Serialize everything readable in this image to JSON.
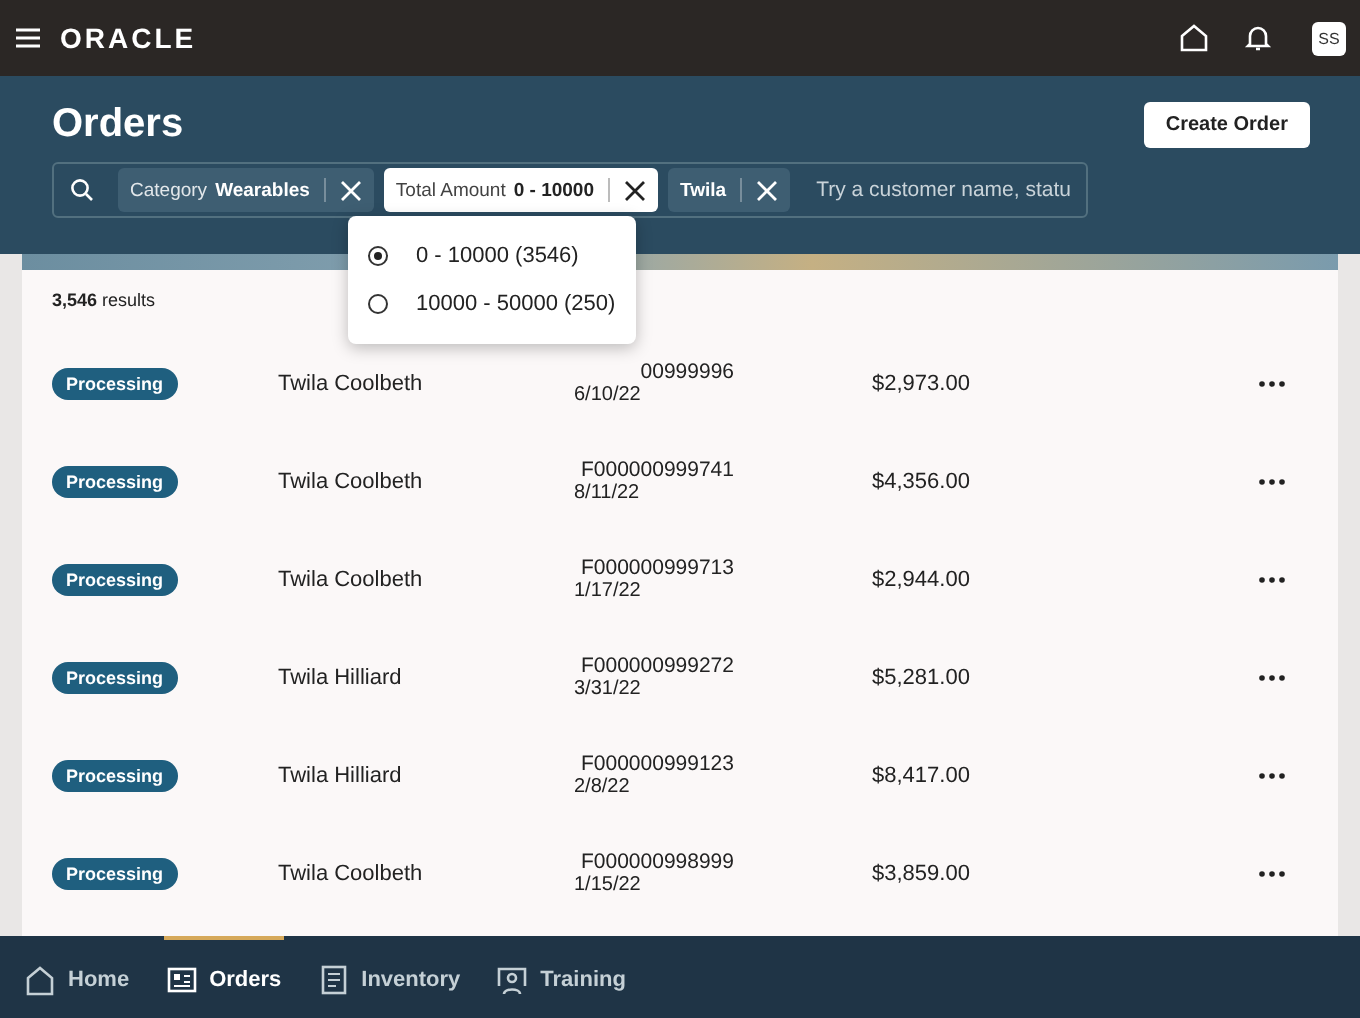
{
  "topbar": {
    "brand": "ORACLE",
    "avatar": "SS"
  },
  "page": {
    "title": "Orders",
    "create_button": "Create Order"
  },
  "filters": {
    "chips": [
      {
        "label": "Category",
        "value": "Wearables",
        "selected": false
      },
      {
        "label": "Total Amount",
        "value": "0 - 10000",
        "selected": true
      },
      {
        "value": "Twila",
        "selected": false
      }
    ],
    "placeholder": "Try a customer name, statu"
  },
  "dropdown": {
    "options": [
      {
        "label": "0 - 10000 (3546)",
        "selected": true
      },
      {
        "label": "10000 - 50000 (250)",
        "selected": false
      }
    ]
  },
  "results": {
    "count": "3,546",
    "label": "results"
  },
  "orders": [
    {
      "status": "Processing",
      "customer": "Twila Coolbeth",
      "order": "00999996",
      "date": "6/10/22",
      "amount": "$2,973.00"
    },
    {
      "status": "Processing",
      "customer": "Twila Coolbeth",
      "order": "F000000999741",
      "date": "8/11/22",
      "amount": "$4,356.00"
    },
    {
      "status": "Processing",
      "customer": "Twila Coolbeth",
      "order": "F000000999713",
      "date": "1/17/22",
      "amount": "$2,944.00"
    },
    {
      "status": "Processing",
      "customer": "Twila Hilliard",
      "order": "F000000999272",
      "date": "3/31/22",
      "amount": "$5,281.00"
    },
    {
      "status": "Processing",
      "customer": "Twila Hilliard",
      "order": "F000000999123",
      "date": "2/8/22",
      "amount": "$8,417.00"
    },
    {
      "status": "Processing",
      "customer": "Twila Coolbeth",
      "order": "F000000998999",
      "date": "1/15/22",
      "amount": "$3,859.00"
    }
  ],
  "nav": [
    {
      "label": "Home",
      "kind": "home",
      "selected": false
    },
    {
      "label": "Orders",
      "kind": "orders",
      "selected": true
    },
    {
      "label": "Inventory",
      "kind": "inventory",
      "selected": false
    },
    {
      "label": "Training",
      "kind": "training",
      "selected": false
    }
  ]
}
